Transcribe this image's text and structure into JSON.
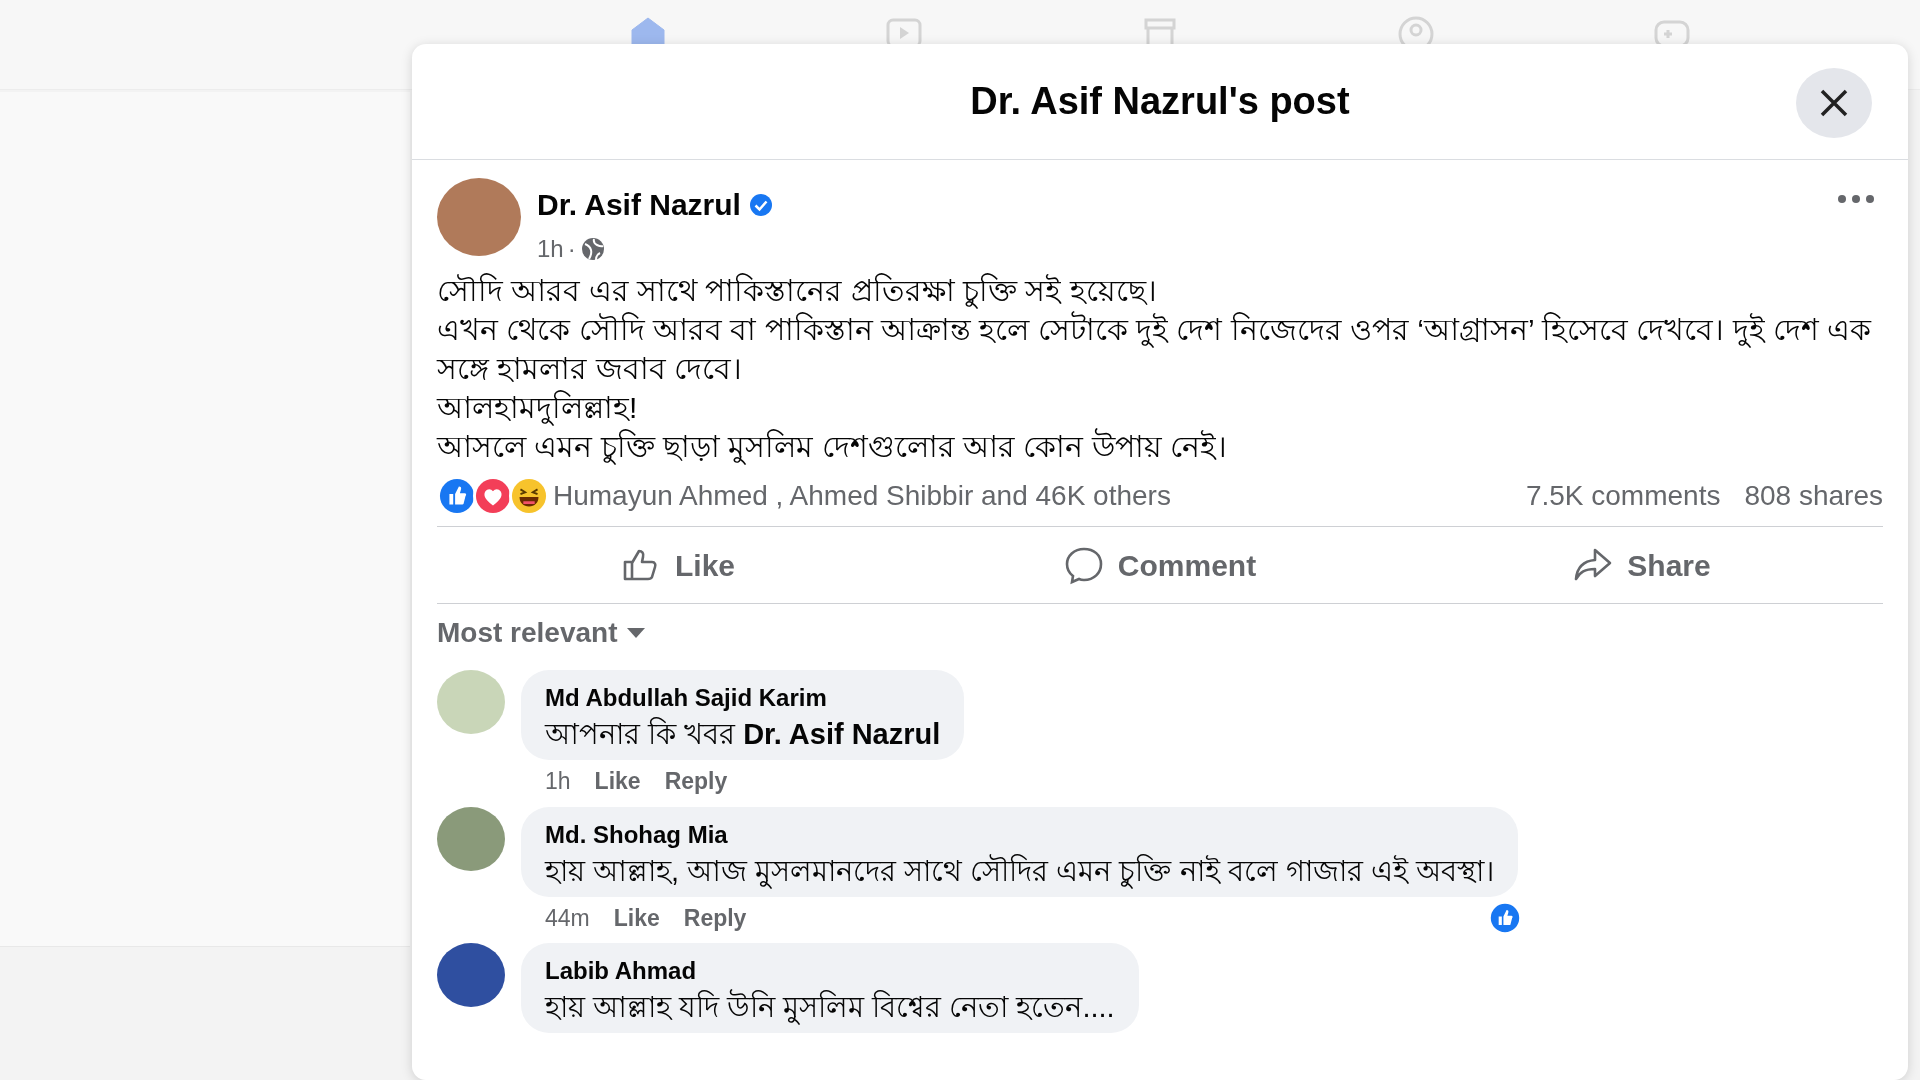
{
  "nav_icons": [
    {
      "kind": "home",
      "selected": true
    },
    {
      "kind": "video",
      "selected": false
    },
    {
      "kind": "market",
      "selected": false
    },
    {
      "kind": "groups",
      "selected": false
    },
    {
      "kind": "gaming",
      "selected": false
    }
  ],
  "modal": {
    "title": "Dr. Asif Nazrul's post"
  },
  "post": {
    "author": "Dr. Asif Nazrul",
    "verified": true,
    "time": "1h",
    "separator": "·",
    "body": [
      "সৌদি আরব এর সাথে পাকিস্তানের প্রতিরক্ষা চুক্তি সই হয়েছে।",
      "এখন থেকে সৌদি আরব বা পাকিস্তান আক্রান্ত হলে সেটাকে দুই দেশ নিজেদের ওপর ‘আগ্রাসন’ হিসেবে দেখবে। দুই দেশ এক সঙ্গে হামলার জবাব দেবে।",
      "আলহামদুলিল্লাহ!",
      "আসলে এমন চুক্তি ছাড়া মুসলিম দেশগুলোর আর কোন উপায় নেই।"
    ],
    "reactions": [
      {
        "kind": "like"
      },
      {
        "kind": "love"
      },
      {
        "kind": "haha"
      }
    ],
    "reactors": "Humayun Ahmed , Ahmed Shibbir and 46K others",
    "comments_count": "7.5K comments",
    "shares_count": "808 shares",
    "actions": [
      {
        "kind": "like",
        "label": "Like"
      },
      {
        "kind": "comment",
        "label": "Comment"
      },
      {
        "kind": "share",
        "label": "Share"
      }
    ]
  },
  "sort": "Most relevant",
  "comments": [
    {
      "author": "Md Abdullah Sajid Karim",
      "text": "আপনার কি খবর **Dr. Asif Nazrul**",
      "time": "1h",
      "actions": [
        "Like",
        "Reply"
      ],
      "color": "#c9d6b8"
    },
    {
      "author": "Md. Shohag Mia",
      "text": "হায় আল্লাহ, আজ মুসলমানদের সাথে সৌদির এমন চুক্তি নাই বলে গাজার এই অবস্থা।",
      "time": "44m",
      "actions": [
        "Like",
        "Reply"
      ],
      "reactions": [
        {
          "kind": "like"
        }
      ],
      "color": "#8a9a7a"
    },
    {
      "author": "Labib Ahmad",
      "text": "হায় আল্লাহ যদি উনি মুসলিম বিশ্বের নেতা হতেন....",
      "color": "#2f4fa0"
    }
  ]
}
